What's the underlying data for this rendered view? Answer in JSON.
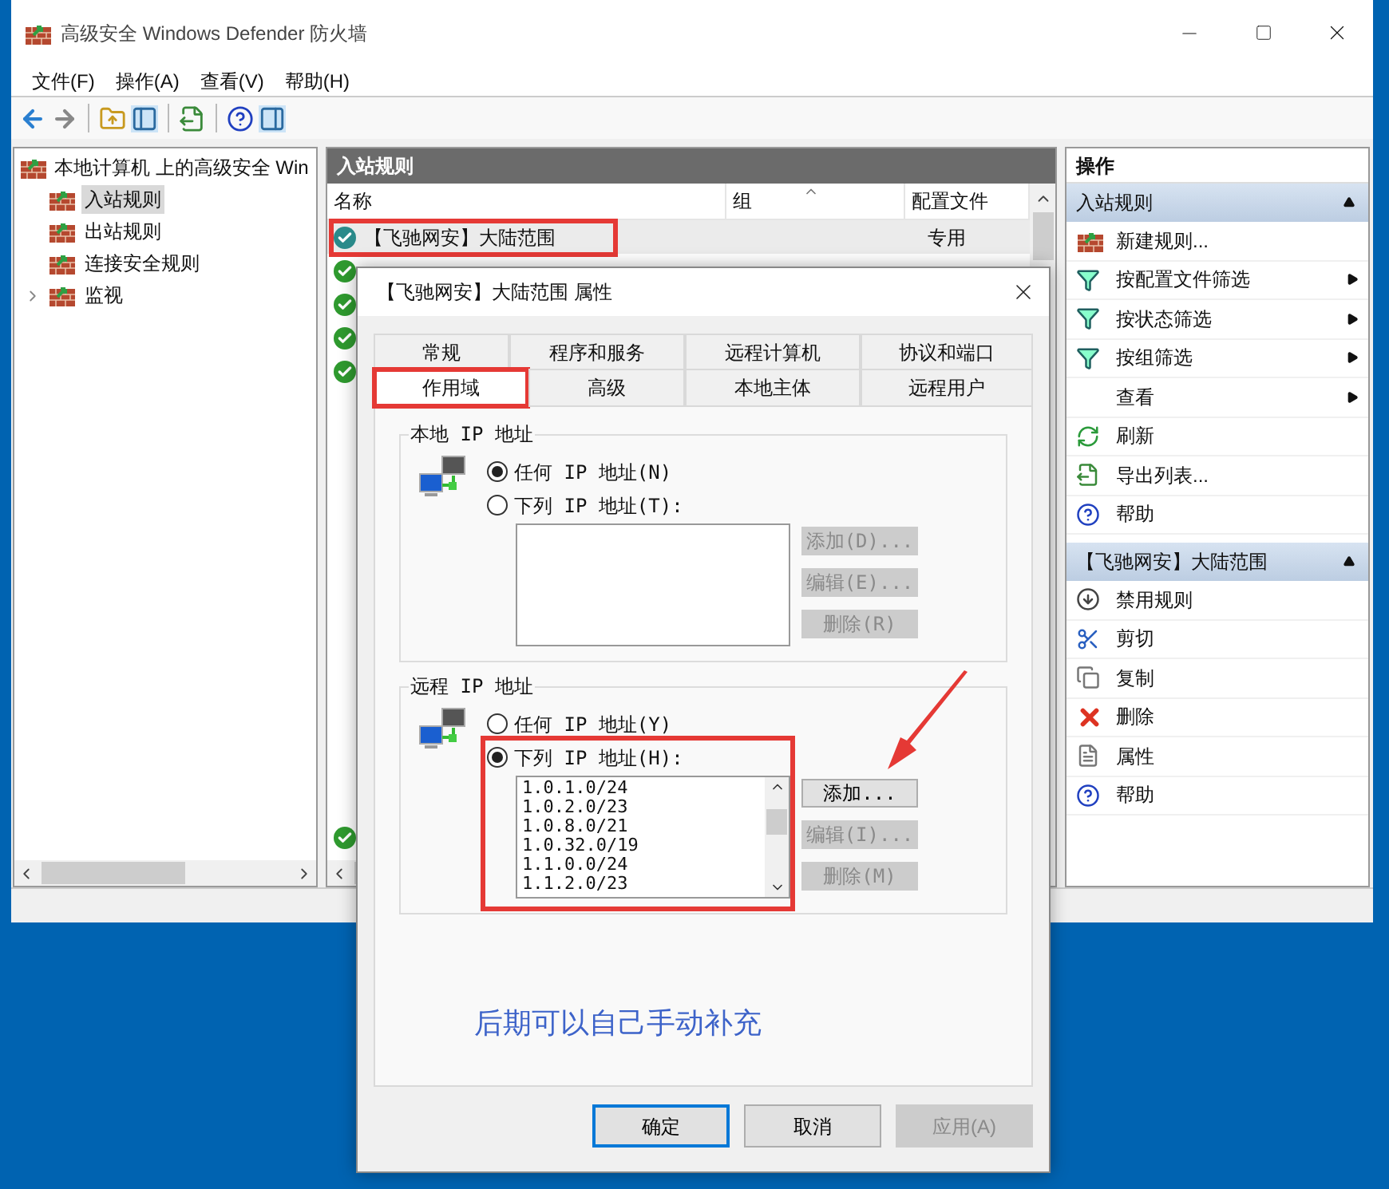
{
  "window": {
    "title": "高级安全 Windows Defender 防火墙"
  },
  "menu": [
    "文件(F)",
    "操作(A)",
    "查看(V)",
    "帮助(H)"
  ],
  "tree": {
    "root": "本地计算机 上的高级安全 Win",
    "items": [
      {
        "label": "入站规则",
        "selected": true,
        "expandable": false
      },
      {
        "label": "出站规则",
        "selected": false,
        "expandable": false
      },
      {
        "label": "连接安全规则",
        "selected": false,
        "expandable": false
      },
      {
        "label": "监视",
        "selected": false,
        "expandable": true
      }
    ]
  },
  "rules": {
    "header": "入站规则",
    "columns": [
      {
        "label": "名称",
        "sorted": false
      },
      {
        "label": "组",
        "sorted": true
      },
      {
        "label": "配置文件",
        "sorted": false
      }
    ],
    "rows": [
      {
        "name": "【飞驰网安】大陆范围",
        "profile": "专用",
        "selected": true,
        "highlighted": true
      },
      {
        "selected": false,
        "highlighted": false
      },
      {
        "selected": false,
        "highlighted": false
      },
      {
        "selected": false,
        "highlighted": false
      },
      {
        "selected": false,
        "highlighted": false
      }
    ],
    "last_row": {
      "selected": false
    }
  },
  "actions": {
    "title": "操作",
    "sections": [
      {
        "title": "入站规则",
        "expanded": true,
        "items": [
          {
            "label": "新建规则...",
            "kind": "new",
            "submenu": false
          },
          {
            "label": "按配置文件筛选",
            "kind": "filter",
            "submenu": true
          },
          {
            "label": "按状态筛选",
            "kind": "filter",
            "submenu": true
          },
          {
            "label": "按组筛选",
            "kind": "filter",
            "submenu": true
          },
          {
            "label": "查看",
            "kind": "none",
            "submenu": true
          },
          {
            "label": "刷新",
            "kind": "refresh",
            "submenu": false
          },
          {
            "label": "导出列表...",
            "kind": "export",
            "submenu": false
          },
          {
            "label": "帮助",
            "kind": "help",
            "submenu": false
          }
        ]
      },
      {
        "title": "【飞驰网安】大陆范围",
        "expanded": true,
        "items": [
          {
            "label": "禁用规则",
            "kind": "disable",
            "submenu": false
          },
          {
            "label": "剪切",
            "kind": "cut",
            "submenu": false
          },
          {
            "label": "复制",
            "kind": "copy",
            "submenu": false
          },
          {
            "label": "删除",
            "kind": "delete",
            "submenu": false
          },
          {
            "label": "属性",
            "kind": "properties",
            "submenu": false
          },
          {
            "label": "帮助",
            "kind": "help",
            "submenu": false
          }
        ]
      }
    ]
  },
  "dialog": {
    "title": "【飞驰网安】大陆范围 属性",
    "tab_rows": [
      [
        {
          "label": "常规",
          "selected": false,
          "highlighted": false
        },
        {
          "label": "程序和服务",
          "selected": false,
          "highlighted": false
        },
        {
          "label": "远程计算机",
          "selected": false,
          "highlighted": false
        },
        {
          "label": "协议和端口",
          "selected": false,
          "highlighted": false
        }
      ],
      [
        {
          "label": "作用域",
          "selected": true,
          "highlighted": true
        },
        {
          "label": "高级",
          "selected": false,
          "highlighted": false
        },
        {
          "label": "本地主体",
          "selected": false,
          "highlighted": false
        },
        {
          "label": "远程用户",
          "selected": false,
          "highlighted": false
        }
      ]
    ],
    "groups": [
      {
        "legend": "本地 IP 地址",
        "highlighted": false,
        "options": [
          {
            "label": "任何 IP 地址(N)",
            "selected": true
          },
          {
            "label": "下列 IP 地址(T):",
            "selected": false
          }
        ],
        "buttons": [
          {
            "label": "添加(D)...",
            "disabled": true
          },
          {
            "label": "编辑(E)...",
            "disabled": true
          },
          {
            "label": "删除(R)",
            "disabled": true
          }
        ]
      },
      {
        "legend": "远程 IP 地址",
        "highlighted": true,
        "options": [
          {
            "label": "任何 IP 地址(Y)",
            "selected": false
          },
          {
            "label": "下列 IP 地址(H):",
            "selected": true
          }
        ],
        "addresses": [
          "1.0.1.0/24",
          "1.0.2.0/23",
          "1.0.8.0/21",
          "1.0.32.0/19",
          "1.1.0.0/24",
          "1.1.2.0/23"
        ],
        "buttons": [
          {
            "label": "添加...",
            "disabled": false
          },
          {
            "label": "编辑(I)...",
            "disabled": true
          },
          {
            "label": "删除(M)",
            "disabled": true
          }
        ]
      }
    ],
    "note": "后期可以自己手动补充",
    "buttons": [
      {
        "label": "确定",
        "default": true,
        "disabled": false
      },
      {
        "label": "取消",
        "default": false,
        "disabled": false
      },
      {
        "label": "应用(A)",
        "default": false,
        "disabled": true
      }
    ]
  }
}
